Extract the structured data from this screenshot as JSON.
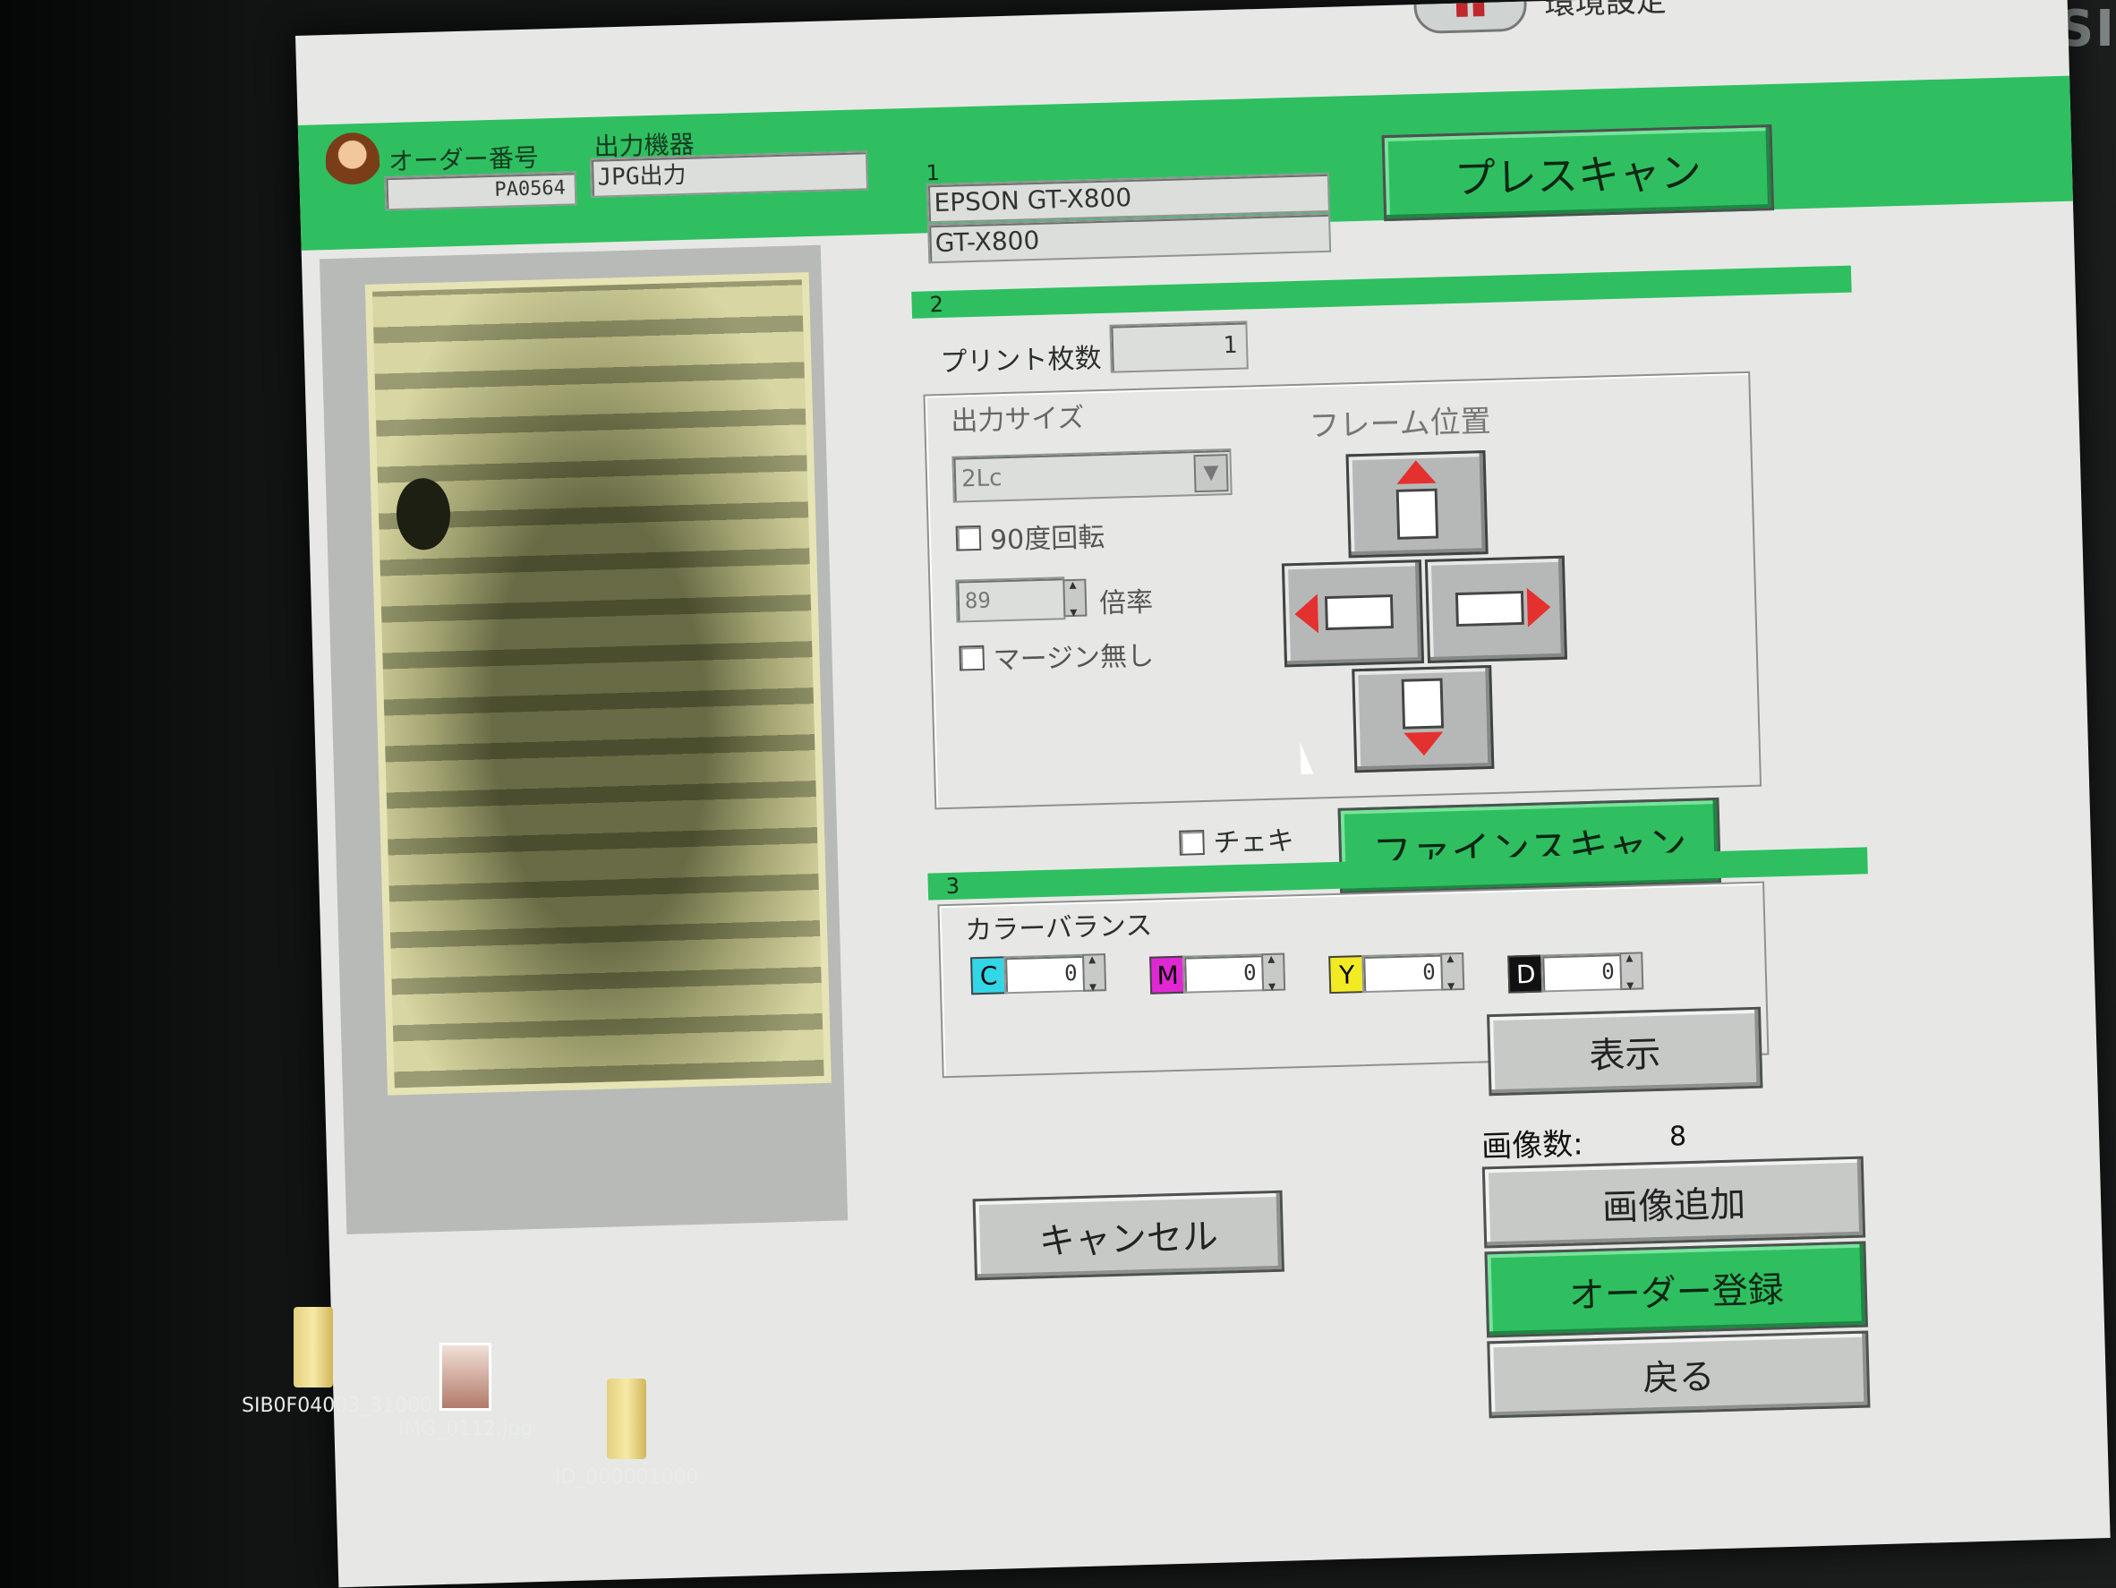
{
  "header": {
    "settings_label": "環境設定",
    "order_label": "オーダー番号",
    "order_value": "PA0564",
    "device_label": "出力機器",
    "device_value": "JPG出力",
    "prescan_label": "プレスキャン"
  },
  "section1": {
    "number": "1",
    "scanner_name": "EPSON GT-X800",
    "scanner_model": "GT-X800"
  },
  "section2": {
    "number": "2",
    "print_count_label": "プリント枚数",
    "print_count_value": "1",
    "output_size_label": "出力サイズ",
    "size_select_value": "2Lc",
    "rotate_label": "90度回転",
    "scale_value": "89",
    "scale_label": "倍率",
    "no_margin_label": "マージン無し",
    "frame_position_label": "フレーム位置",
    "cheki_label": "チェキ",
    "finescan_label": "ファインスキャン"
  },
  "section3": {
    "number": "3",
    "color_balance_label": "カラーバランス",
    "channels": [
      {
        "tag": "C",
        "value": "0",
        "color": "#33d6e6"
      },
      {
        "tag": "M",
        "value": "0",
        "color": "#e028d2"
      },
      {
        "tag": "Y",
        "value": "0",
        "color": "#f2ea22"
      },
      {
        "tag": "D",
        "value": "0",
        "color": "#111111"
      }
    ],
    "show_label": "表示"
  },
  "footer": {
    "image_count_label": "画像数:",
    "image_count_value": "8",
    "cancel_label": "キャンセル",
    "add_image_label": "画像追加",
    "order_register_label": "オーダー登録",
    "back_label": "戻る"
  },
  "desktop_icons": [
    {
      "label": "SIB0F04003_31000",
      "kind": "folder"
    },
    {
      "label": "IMG_0112.jpg",
      "kind": "photo"
    },
    {
      "label": "ID_000001000",
      "kind": "folder"
    }
  ],
  "colors": {
    "accent_green": "#2fbf60",
    "panel_gray": "#e7e8e6"
  }
}
